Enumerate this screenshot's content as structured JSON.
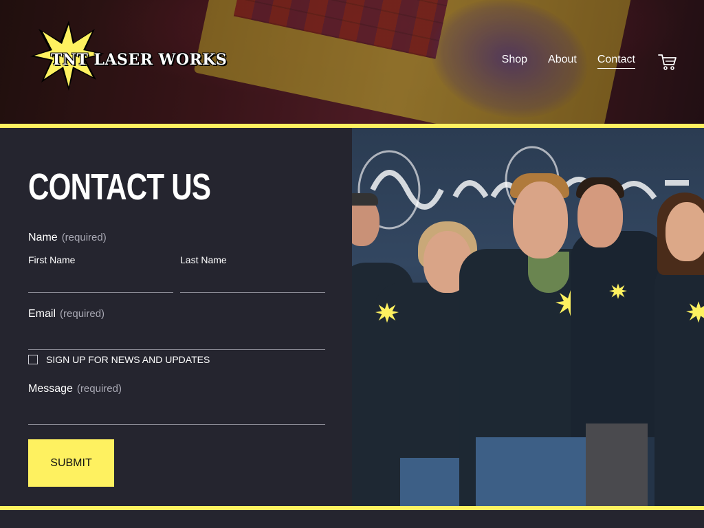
{
  "brand": {
    "name": "TNT LASER WORKS"
  },
  "nav": {
    "items": [
      {
        "label": "Shop"
      },
      {
        "label": "About"
      },
      {
        "label": "Contact"
      }
    ],
    "cart_icon": "shopping-cart-icon"
  },
  "colors": {
    "accent": "#fef160",
    "panel_background": "#25252f",
    "label_muted": "#a9a9b4"
  },
  "contact": {
    "title": "CONTACT US",
    "name": {
      "label": "Name",
      "required": "(required)"
    },
    "first_name": {
      "label": "First Name",
      "value": ""
    },
    "last_name": {
      "label": "Last Name",
      "value": ""
    },
    "email": {
      "label": "Email",
      "required": "(required)",
      "value": ""
    },
    "newsletter": {
      "label": "SIGN UP FOR NEWS AND UPDATES",
      "checked": false
    },
    "message": {
      "label": "Message",
      "required": "(required)",
      "value": ""
    },
    "submit_label": "SUBMIT"
  }
}
